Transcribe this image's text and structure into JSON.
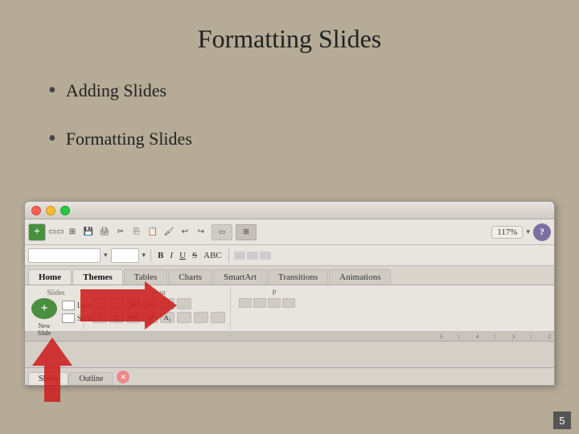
{
  "slide": {
    "title": "Formatting Slides",
    "bullets": [
      "Adding Slides",
      "Formatting Slides"
    ]
  },
  "ppt_window": {
    "title_bar": {
      "zoom": "117%"
    },
    "ribbon": {
      "tabs": [
        {
          "label": "Home",
          "active": true
        },
        {
          "label": "Themes",
          "highlighted": true
        },
        {
          "label": "Tables"
        },
        {
          "label": "Charts"
        },
        {
          "label": "SmartArt"
        },
        {
          "label": "Transitions"
        },
        {
          "label": "Animations"
        }
      ],
      "groups": [
        {
          "name": "Slides",
          "buttons": [
            {
              "label": "New Slide"
            },
            {
              "label": "Layout ▾"
            },
            {
              "label": "Section ▾"
            }
          ]
        },
        {
          "name": "Font"
        }
      ]
    },
    "bottom_tabs": [
      {
        "label": "Slides",
        "active": true
      },
      {
        "label": "Outline"
      }
    ]
  },
  "page_number": "5",
  "icons": {
    "close": "✕",
    "minimize": "−",
    "maximize": "+"
  }
}
